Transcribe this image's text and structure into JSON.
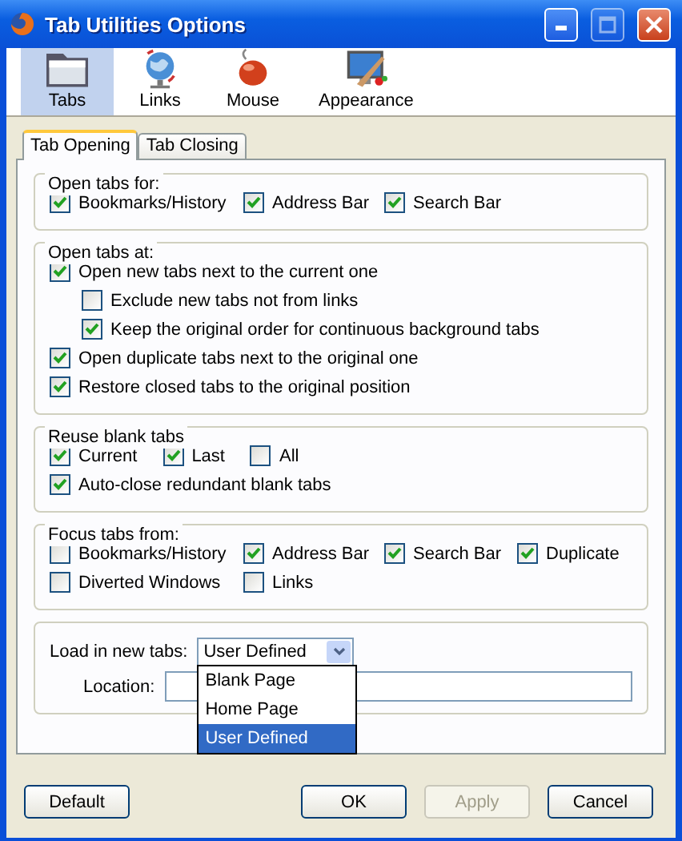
{
  "window": {
    "title": "Tab Utilities Options"
  },
  "toolbar": [
    {
      "label": "Tabs",
      "kind": "tabs",
      "selected": true
    },
    {
      "label": "Links",
      "kind": "links",
      "selected": false
    },
    {
      "label": "Mouse",
      "kind": "mouse",
      "selected": false
    },
    {
      "label": "Appearance",
      "kind": "appearance",
      "selected": false
    }
  ],
  "tabs": [
    {
      "label": "Tab Opening",
      "selected": true
    },
    {
      "label": "Tab Closing",
      "selected": false
    }
  ],
  "groups": [
    {
      "title": "Open tabs for:",
      "kind": "grid",
      "rows": [
        [
          {
            "label": "Bookmarks/History",
            "checked": true
          },
          {
            "label": "Address Bar",
            "checked": true
          },
          {
            "label": "Search Bar",
            "checked": true
          }
        ]
      ]
    },
    {
      "title": "Open tabs at:",
      "kind": "flow",
      "rows": [
        [
          {
            "label": "Open new tabs next to the current one",
            "checked": true,
            "children": [
              {
                "label": "Exclude new tabs not from links",
                "checked": false
              },
              {
                "label": "Keep the original order for continuous background tabs",
                "checked": true
              }
            ]
          }
        ],
        [
          {
            "label": "Open duplicate tabs next to the original one",
            "checked": true
          }
        ],
        [
          {
            "label": "Restore closed tabs to the original position",
            "checked": true
          }
        ]
      ]
    },
    {
      "title": "Reuse blank tabs",
      "kind": "flow",
      "rows": [
        [
          {
            "label": "Current",
            "checked": true
          },
          {
            "label": "Last",
            "checked": true
          },
          {
            "label": "All",
            "checked": false
          }
        ],
        [
          {
            "label": "Auto-close redundant blank tabs",
            "checked": true
          }
        ]
      ]
    },
    {
      "title": "Focus tabs from:",
      "kind": "grid",
      "rows": [
        [
          {
            "label": "Bookmarks/History",
            "checked": false
          },
          {
            "label": "Address Bar",
            "checked": true
          },
          {
            "label": "Search Bar",
            "checked": true
          },
          {
            "label": "Duplicate",
            "checked": true
          }
        ],
        [
          {
            "label": "Diverted Windows",
            "checked": false
          },
          {
            "label": "Links",
            "checked": false
          }
        ]
      ]
    }
  ],
  "load": {
    "label": "Load in new tabs:",
    "value": "User Defined",
    "options": [
      {
        "label": "Blank Page",
        "selected": false
      },
      {
        "label": "Home Page",
        "selected": false
      },
      {
        "label": "User Defined",
        "selected": true
      }
    ],
    "location_label": "Location:"
  },
  "buttons": [
    {
      "label": "Default",
      "disabled": false
    },
    {
      "label": "OK",
      "disabled": false
    },
    {
      "label": "Apply",
      "disabled": true
    },
    {
      "label": "Cancel",
      "disabled": false
    }
  ]
}
